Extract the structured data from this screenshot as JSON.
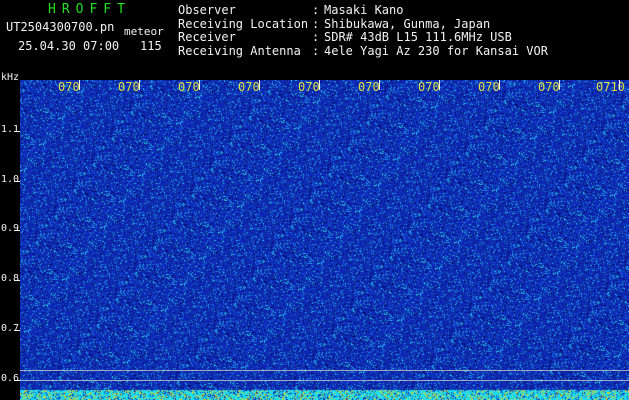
{
  "header": {
    "brand": "HROFFT",
    "file_name": "UT2504300700.pn",
    "subtitle": "meteor",
    "date_time": "25.04.30 07:00",
    "count": "115"
  },
  "info": [
    {
      "label": "Observer",
      "value": "Masaki Kano"
    },
    {
      "label": "Receiving Location",
      "value": "Shibukawa, Gunma, Japan"
    },
    {
      "label": "Receiver",
      "value": "SDR# 43dB L15 111.6MHz USB"
    },
    {
      "label": "Receiving Antenna",
      "value": "4ele Yagi Az 230 for Kansai VOR"
    }
  ],
  "separator": ":",
  "y_axis": {
    "unit": "kHz",
    "labels": [
      "1.1",
      "1.0",
      "0.9",
      "0.8",
      "0.7",
      "0.6"
    ]
  },
  "x_axis": {
    "labels": [
      "070",
      "070",
      "070",
      "070",
      "070",
      "070",
      "070",
      "070",
      "070",
      "0710"
    ]
  },
  "colors": {
    "background": "#000000",
    "brand": "#1fe01f",
    "text": "#f2f2f2",
    "x_labels": "#e0e040",
    "waterfall_base": "#1a2fb0",
    "waterfall_speckle": "#3ac6e6",
    "bottom_strip": "#19c8e8"
  }
}
